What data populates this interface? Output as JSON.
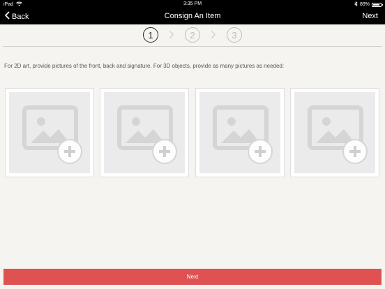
{
  "status_bar": {
    "device": "iPad",
    "time": "3:35 PM",
    "battery": "89%",
    "battery_level": 0.89
  },
  "nav": {
    "back_label": "Back",
    "title": "Consign An Item",
    "next_label": "Next"
  },
  "steps": [
    "1",
    "2",
    "3"
  ],
  "instruction": "For 2D art, provide pictures of the front, back and signature.  For 3D objects, provide as many pictures as needed:",
  "photo_slots": [
    {
      "icon": "add-photo-icon"
    },
    {
      "icon": "add-photo-icon"
    },
    {
      "icon": "add-photo-icon"
    },
    {
      "icon": "add-photo-icon"
    }
  ],
  "next_button": {
    "label": "Next"
  },
  "colors": {
    "background": "#f5f4f0",
    "bar": "#000000",
    "accent": "#e05252",
    "inactive_step": "#bdbdbd"
  }
}
